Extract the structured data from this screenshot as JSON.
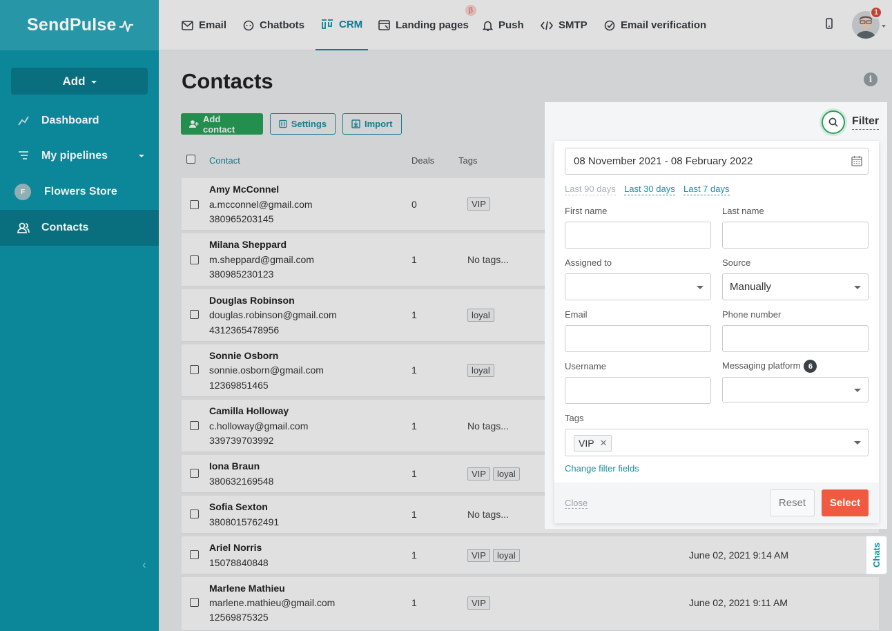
{
  "app": {
    "brand": "SendPulse"
  },
  "sidebar": {
    "add_label": "Add",
    "items": [
      {
        "label": "Dashboard"
      },
      {
        "label": "My pipelines"
      },
      {
        "label": "Flowers Store",
        "avatar_letter": "F"
      },
      {
        "label": "Contacts"
      }
    ]
  },
  "topnav": {
    "tabs": [
      {
        "label": "Email"
      },
      {
        "label": "Chatbots"
      },
      {
        "label": "CRM"
      },
      {
        "label": "Landing pages"
      },
      {
        "label": "Push"
      },
      {
        "label": "SMTP"
      },
      {
        "label": "Email verification"
      }
    ],
    "beta": "β",
    "notifications": "1"
  },
  "main": {
    "title": "Contacts",
    "buttons": {
      "add_contact": "Add contact",
      "settings": "Settings",
      "import": "Import"
    },
    "columns": {
      "contact": "Contact",
      "deals": "Deals",
      "tags": "Tags"
    },
    "rows": [
      {
        "name": "Amy McConnel",
        "line2": "a.mcconnel@gmail.com",
        "line3": "380965203145",
        "deals": "0",
        "tags": [
          "VIP"
        ],
        "date": ""
      },
      {
        "name": "Milana Sheppard",
        "line2": "m.sheppard@gmail.com",
        "line3": "380985230123",
        "deals": "1",
        "tags": [],
        "no_tags": "No tags...",
        "date": ""
      },
      {
        "name": "Douglas Robinson",
        "line2": "douglas.robinson@gmail.com",
        "line3": "4312365478956",
        "deals": "1",
        "tags": [
          "loyal"
        ],
        "date": ""
      },
      {
        "name": "Sonnie Osborn",
        "line2": "sonnie.osborn@gmail.com",
        "line3": "12369851465",
        "deals": "1",
        "tags": [
          "loyal"
        ],
        "date": ""
      },
      {
        "name": "Camilla Holloway",
        "line2": "c.holloway@gmail.com",
        "line3": "339739703992",
        "deals": "1",
        "tags": [],
        "no_tags": "No tags...",
        "date": ""
      },
      {
        "name": "Iona Braun",
        "line2": "380632169548",
        "line3": "",
        "deals": "1",
        "tags": [
          "VIP",
          "loyal"
        ],
        "date": ""
      },
      {
        "name": "Sofia Sexton",
        "line2": "3808015762491",
        "line3": "",
        "deals": "1",
        "tags": [],
        "no_tags": "No tags...",
        "date": ""
      },
      {
        "name": "Ariel Norris",
        "line2": "15078840848",
        "line3": "",
        "deals": "1",
        "tags": [
          "VIP",
          "loyal"
        ],
        "date": "June 02, 2021 9:14 AM"
      },
      {
        "name": "Marlene Mathieu",
        "line2": "marlene.mathieu@gmail.com",
        "line3": "12569875325",
        "deals": "1",
        "tags": [
          "VIP"
        ],
        "date": "June 02, 2021 9:11 AM"
      }
    ]
  },
  "chats_label": "Chats",
  "filter": {
    "title": "Filter",
    "date_range": "08 November 2021 - 08 February 2022",
    "quick_ranges": [
      "Last 90 days",
      "Last 30 days",
      "Last 7 days"
    ],
    "fields": {
      "first_name": {
        "label": "First name",
        "value": ""
      },
      "last_name": {
        "label": "Last name",
        "value": ""
      },
      "assigned_to": {
        "label": "Assigned to",
        "value": ""
      },
      "source": {
        "label": "Source",
        "value": "Manually"
      },
      "email": {
        "label": "Email",
        "value": ""
      },
      "phone": {
        "label": "Phone number",
        "value": ""
      },
      "username": {
        "label": "Username",
        "value": ""
      },
      "messaging_platform": {
        "label": "Messaging platform",
        "badge": "6",
        "value": ""
      },
      "tags": {
        "label": "Tags",
        "chips": [
          "VIP"
        ]
      }
    },
    "change_fields": "Change filter fields",
    "close": "Close",
    "reset": "Reset",
    "select": "Select"
  },
  "colors": {
    "sidebar": "#0d8fa3",
    "accent": "#0f8ea3",
    "green": "#29a25b",
    "select": "#ef5a40"
  }
}
